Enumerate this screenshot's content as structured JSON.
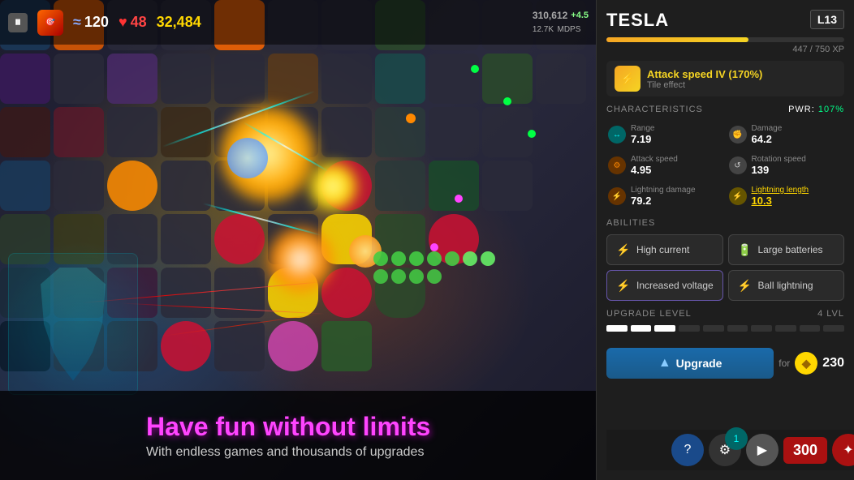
{
  "game": {
    "wave": "120",
    "health": "48",
    "score": "32,484",
    "total_score": "310,612",
    "score_delta": "+4.5",
    "mdps": "12.7K",
    "promo_title": "Have fun without limits",
    "promo_subtitle": "With endless games and thousands of upgrades"
  },
  "panel": {
    "tower_name": "TESLA",
    "level": "L13",
    "xp_current": "447",
    "xp_max": "750",
    "xp_label": "447 / 750 XP",
    "xp_percent": 59.6,
    "tile_effect_name": "Attack speed IV (170%)",
    "tile_effect_label": "Tile effect",
    "section_characteristics": "CHARACTERISTICS",
    "pwr_label": "PWR:",
    "pwr_value": "107%",
    "stats": [
      {
        "label": "Range",
        "value": "7.19",
        "icon": "↔",
        "icon_class": "teal"
      },
      {
        "label": "Damage",
        "value": "64.2",
        "icon": "✊",
        "icon_class": "gray"
      },
      {
        "label": "Attack speed",
        "value": "4.95",
        "icon": "⚙",
        "icon_class": "orange",
        "highlighted": false
      },
      {
        "label": "Rotation speed",
        "value": "139",
        "icon": "↺",
        "icon_class": "gray"
      },
      {
        "label": "Lightning damage",
        "value": "79.2",
        "icon": "⚡",
        "icon_class": "orange"
      },
      {
        "label": "Lightning length",
        "value": "10.3",
        "icon": "⚡",
        "icon_class": "yellow",
        "highlighted": true
      }
    ],
    "section_abilities": "ABILITIES",
    "abilities": [
      {
        "label": "High current",
        "icon": "⚡"
      },
      {
        "label": "Large batteries",
        "icon": "🔋"
      },
      {
        "label": "Increased voltage",
        "icon": "⚡"
      },
      {
        "label": "Ball lightning",
        "icon": "⚡"
      }
    ],
    "section_upgrade": "UPGRADE LEVEL",
    "upgrade_bars_filled": 3,
    "upgrade_bars_total": 10,
    "upgrade_lvl_label": "4 LVL",
    "upgrade_btn_label": "Upgrade",
    "upgrade_for_label": "for",
    "upgrade_cost": "230"
  },
  "bottom_actions": {
    "score_display": "300",
    "icons": [
      "?",
      "⚙",
      "✦",
      "×"
    ]
  }
}
